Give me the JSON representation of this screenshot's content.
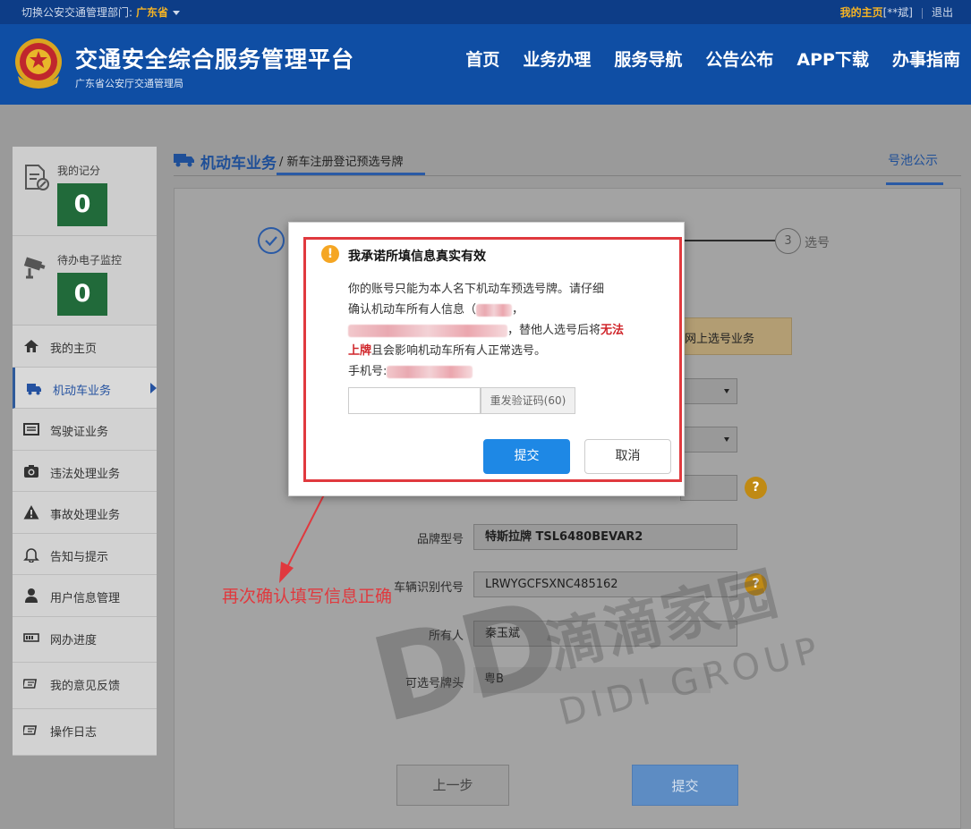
{
  "topbar": {
    "switch_label": "切换公安交通管理部门:",
    "province": "广东省",
    "my_home": "我的主页",
    "user_masked": "[**斌]",
    "logout": "退出"
  },
  "header": {
    "title": "交通安全综合服务管理平台",
    "subtitle": "广东省公安厅交通管理局",
    "nav": [
      "首页",
      "业务办理",
      "服务导航",
      "公告公布",
      "APP下载",
      "办事指南"
    ]
  },
  "sidebar": {
    "points_label": "我的记分",
    "points_value": "0",
    "monitor_label": "待办电子监控",
    "monitor_value": "0",
    "items": [
      {
        "label": "我的主页",
        "icon": "home-icon"
      },
      {
        "label": "机动车业务",
        "icon": "truck-icon"
      },
      {
        "label": "驾驶证业务",
        "icon": "id-card-icon"
      },
      {
        "label": "违法处理业务",
        "icon": "camera-icon"
      },
      {
        "label": "事故处理业务",
        "icon": "warning-icon"
      },
      {
        "label": "告知与提示",
        "icon": "bell-icon"
      },
      {
        "label": "用户信息管理",
        "icon": "user-icon"
      },
      {
        "label": "网办进度",
        "icon": "progress-icon"
      },
      {
        "label": "我的意见反馈",
        "icon": "feedback-icon"
      },
      {
        "label": "操作日志",
        "icon": "log-icon"
      }
    ]
  },
  "breadcrumb": {
    "section": "机动车业务",
    "separator": "/",
    "page": "新车注册登记预选号牌",
    "pool_link": "号池公示"
  },
  "steps": {
    "step3_number": "3",
    "step3_label": "选号"
  },
  "notice_text": "网上选号业务",
  "form": {
    "brand_label": "品牌型号",
    "brand_value": "特斯拉牌 TSL6480BEVAR2",
    "vin_label": "车辆识别代号",
    "vin_value": "LRWYGCFSXNC485162",
    "owner_label": "所有人",
    "owner_value": "秦玉斌",
    "prefix_label": "可选号牌头",
    "prefix_value": "粤B",
    "help_mark": "?"
  },
  "buttons": {
    "prev": "上一步",
    "submit": "提交"
  },
  "watermark": {
    "logo": "DD",
    "cn": "滴滴家园",
    "en": "DIDI GROUP"
  },
  "annotation": "再次确认填写信息正确",
  "modal": {
    "title": "我承诺所填信息真实有效",
    "warn_mark": "!",
    "line1": "你的账号只能为本人名下机动车预选号牌。请仔细",
    "line2a": "确认机动车所有人信息（",
    "line2b": "，",
    "line3b": "，替他人选号后将",
    "line3_red": "无法",
    "line4_red": "上牌",
    "line4b": "且会影响机动车所有人正常选号。",
    "line5": "手机号:",
    "resend": "重发验证码(60)",
    "submit": "提交",
    "cancel": "取消"
  }
}
